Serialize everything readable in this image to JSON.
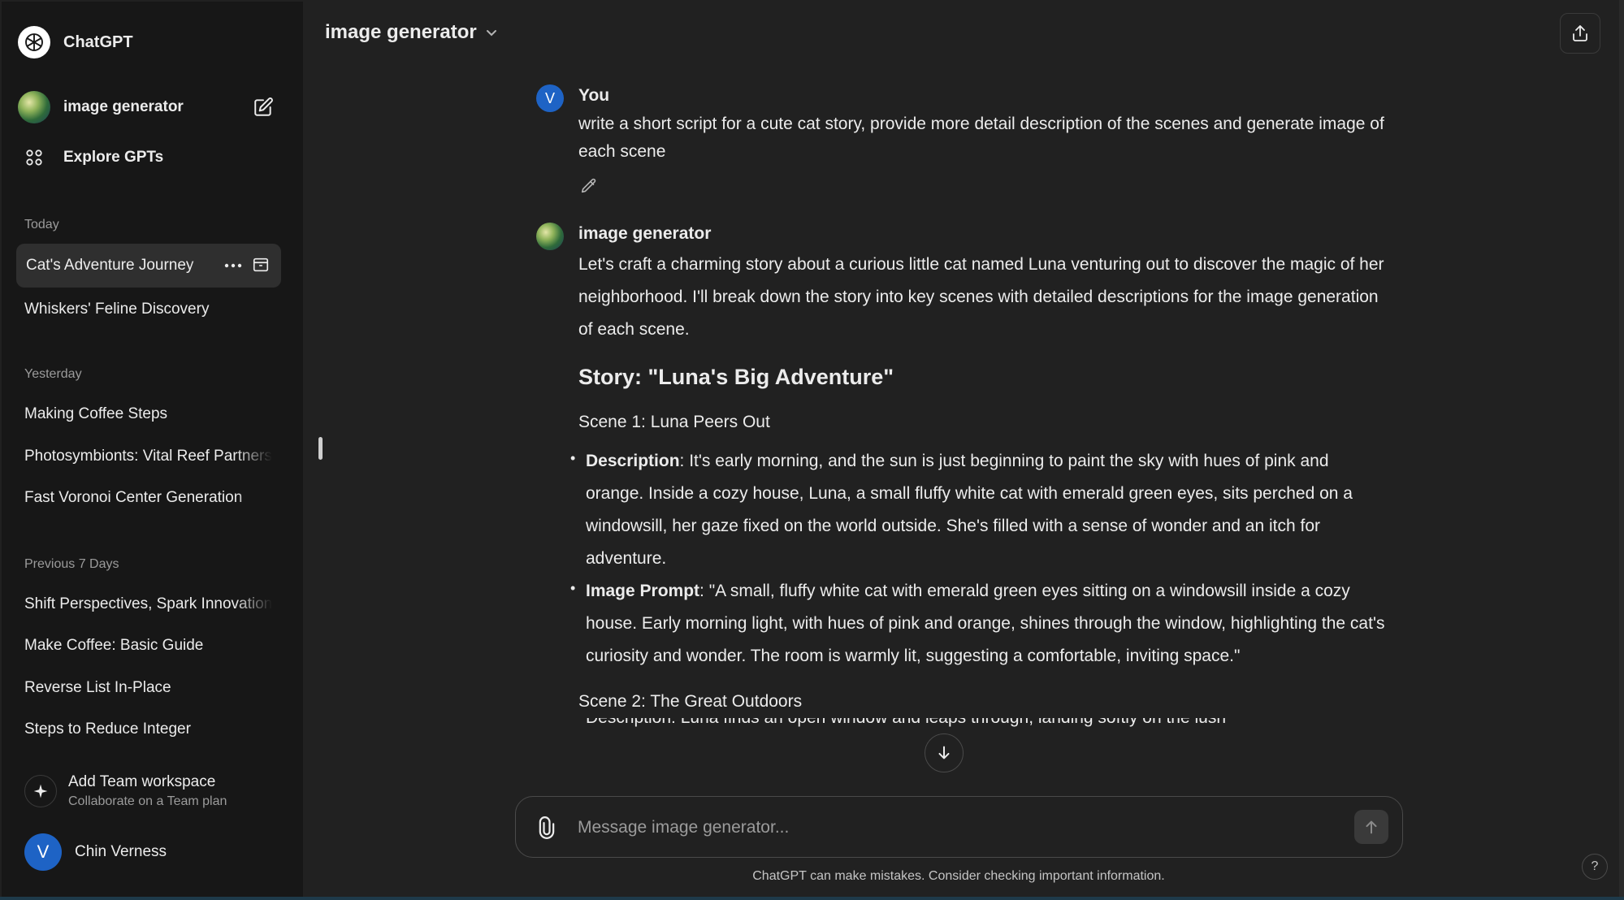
{
  "sidebar": {
    "brand": "ChatGPT",
    "gpt_name": "image generator",
    "explore": "Explore GPTs",
    "sections": {
      "today": "Today",
      "yesterday": "Yesterday",
      "previous7": "Previous 7 Days"
    },
    "today_items": [
      "Cat's Adventure Journey",
      "Whiskers' Feline Discovery"
    ],
    "yesterday_items": [
      "Making Coffee Steps",
      "Photosymbionts: Vital Reef Partners",
      "Fast Voronoi Center Generation"
    ],
    "previous_items": [
      "Shift Perspectives, Spark Innovation",
      "Make Coffee: Basic Guide",
      "Reverse List In-Place",
      "Steps to Reduce Integer"
    ],
    "team_title": "Add Team workspace",
    "team_subtitle": "Collaborate on a Team plan",
    "user_initial": "V",
    "user_name": "Chin Verness"
  },
  "header": {
    "title": "image generator"
  },
  "conversation": {
    "user_initial": "V",
    "user_author": "You",
    "user_message": "write a short script for a cute cat story, provide more detail description of the scenes and generate image of each scene",
    "bot_author": "image generator",
    "bot_intro": "Let's craft a charming story about a curious little cat named Luna venturing out to discover the magic of her neighborhood. I'll break down the story into key scenes with detailed descriptions for the image generation of each scene.",
    "story_heading": "Story: \"Luna's Big Adventure\"",
    "scene1_title": "Scene 1: Luna Peers Out",
    "desc_label": "Description",
    "scene1_description": ": It's early morning, and the sun is just beginning to paint the sky with hues of pink and orange. Inside a cozy house, Luna, a small fluffy white cat with emerald green eyes, sits perched on a windowsill, her gaze fixed on the world outside. She's filled with a sense of wonder and an itch for adventure.",
    "prompt_label": "Image Prompt",
    "scene1_prompt": ": \"A small, fluffy white cat with emerald green eyes sitting on a windowsill inside a cozy house. Early morning light, with hues of pink and orange, shines through the window, highlighting the cat's curiosity and wonder. The room is warmly lit, suggesting a comfortable, inviting space.\"",
    "scene2_title": "Scene 2: The Great Outdoors",
    "scene2_partial": "Description: Luna finds an open window and leaps through, landing softly on the lush"
  },
  "composer": {
    "placeholder": "Message image generator...",
    "disclaimer": "ChatGPT can make mistakes. Consider checking important information.",
    "help": "?"
  }
}
